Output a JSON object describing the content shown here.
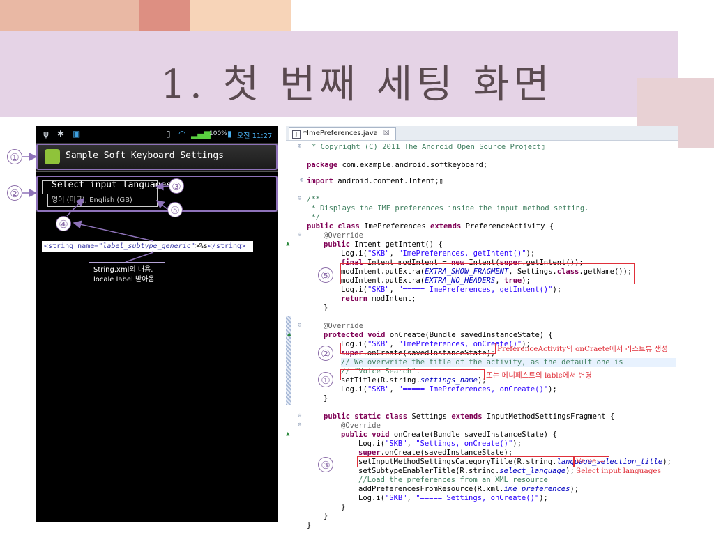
{
  "slide": {
    "title": "1. 첫 번째 세팅 화면"
  },
  "phone": {
    "status": {
      "time": "오전 11:27",
      "battery": "100%"
    },
    "app_title": "Sample Soft Keyboard Settings",
    "pref_title": "Select input languages",
    "pref_summary": "영어 (미국), English (GB)",
    "xml_snippet": {
      "open": "<string name=",
      "attr_value": "\"label_subtype_generic\"",
      "value": ">%s",
      "close": "</string>"
    },
    "note_line1": "String.xml의 내용.",
    "note_line2": "locale label 받아옴"
  },
  "editor": {
    "tab_label": "*ImePreferences.java",
    "tab_close": "☒",
    "lines": {
      "l1": "* Copyright (C) 2011 The Android Open Source Project",
      "l2_kw": "package",
      "l2": " com.example.android.softkeyboard;",
      "l3_kw": "import",
      "l3": " android.content.Intent;",
      "l4": "/**",
      "l5": " * Displays the IME preferences inside the input method setting.",
      "l6": " */",
      "l7_kw1": "public class",
      "l7_a": " ImePreferences ",
      "l7_kw2": "extends",
      "l7_b": " PreferenceActivity {",
      "l8": "@Override",
      "l9_kw": "public",
      "l9": " Intent getIntent() {",
      "l10_a": "Log.i(",
      "l10_s1": "\"SKB\"",
      "l10_b": ", ",
      "l10_s2": "\"ImePreferences, getIntent()\"",
      "l10_c": ");",
      "l11_kw": "final",
      "l11_a": " Intent modIntent = ",
      "l11_kw2": "new",
      "l11_b": " Intent(",
      "l11_kw3": "super",
      "l11_c": ".getIntent());",
      "l12_a": "modIntent.putExtra(",
      "l12_i": "EXTRA_SHOW_FRAGMENT",
      "l12_b": ", Settings.",
      "l12_kw": "class",
      "l12_c": ".getName());",
      "l13_a": "modIntent.putExtra(",
      "l13_i": "EXTRA_NO_HEADERS",
      "l13_b": ", ",
      "l13_kw": "true",
      "l13_c": ");",
      "l14_a": "Log.i(",
      "l14_s1": "\"SKB\"",
      "l14_b": ", ",
      "l14_s2": "\"===== ImePreferences, getIntent()\"",
      "l14_c": ");",
      "l15_kw": "return",
      "l15": " modIntent;",
      "l16": "}",
      "l17": "@Override",
      "l18_kw": "protected void",
      "l18": " onCreate(Bundle savedInstanceState) {",
      "l19_a": "Log.i(",
      "l19_s1": "\"SKB\"",
      "l19_b": ", ",
      "l19_s2": "\"ImePreferences, onCreate()\"",
      "l19_c": ");",
      "l20_kw": "super",
      "l20": ".onCreate(savedInstanceState);",
      "l21": "// We overwrite the title of the activity, as the default one is",
      "l22": "// \"Voice Search\".",
      "l23_a": "setTitle(R.string.",
      "l23_i": "settings_name",
      "l23_b": ");",
      "l24_a": "Log.i(",
      "l24_s1": "\"SKB\"",
      "l24_b": ", ",
      "l24_s2": "\"===== ImePreferences, onCreate()\"",
      "l24_c": ");",
      "l25": "}",
      "l26_kw": "public static class",
      "l26_a": " Settings ",
      "l26_kw2": "extends",
      "l26_b": " InputMethodSettingsFragment {",
      "l27": "@Override",
      "l28_kw": "public void",
      "l28": " onCreate(Bundle savedInstanceState) {",
      "l29_a": "Log.i(",
      "l29_s1": "\"SKB\"",
      "l29_b": ", ",
      "l29_s2": "\"Settings, onCreate()\"",
      "l29_c": ");",
      "l30_kw": "super",
      "l30": ".onCreate(savedInstanceState);",
      "l31_a": "setInputMethodSettingsCategoryTitle(R.string.",
      "l31_i": "language_selection_title",
      "l31_b": ");",
      "l32_a": "setSubtypeEnablerTitle(R.string.",
      "l32_i": "select_language",
      "l32_b": ");",
      "l33": "//Load the preferences from an XML resource",
      "l34_a": "addPreferencesFromResource(R.xml.",
      "l34_i": "ime_preferences",
      "l34_b": ");",
      "l35_a": "Log.i(",
      "l35_s1": "\"SKB\"",
      "l35_b": ", ",
      "l35_s2": "\"===== Settings, onCreate()\"",
      "l35_c": ");",
      "l36": "}",
      "l37": "}"
    }
  },
  "annotations": {
    "n1": "①",
    "n2": "②",
    "n3": "③",
    "n4": "④",
    "n5": "⑤",
    "red_super": "PreferenceActivity의 onCraete에서 리스트뷰 생성",
    "red_title": "또는 메니페스트의 lable에서 변경",
    "red_value1": "Value =",
    "red_value2": "Select input languages"
  }
}
